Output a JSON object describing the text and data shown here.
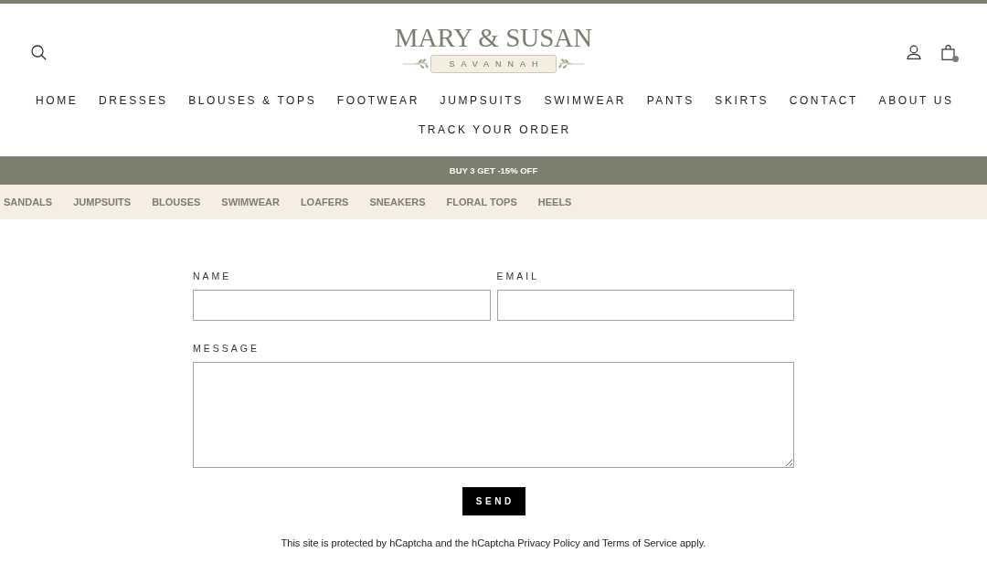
{
  "header": {
    "logo": {
      "title": "MARY & SUSAN",
      "subtitle": "SAVANNAH"
    },
    "cart": {
      "has_items": true
    }
  },
  "nav": {
    "items": [
      "HOME",
      "DRESSES",
      "BLOUSES & TOPS",
      "FOOTWEAR",
      "JUMPSUITS",
      "SWIMWEAR",
      "PANTS",
      "SKIRTS",
      "CONTACT",
      "ABOUT US",
      "TRACK YOUR ORDER"
    ]
  },
  "announcement_bar": {
    "text": "BUY 3 GET -15% OFF"
  },
  "category_strip": {
    "items": [
      "SANDALS",
      "JUMPSUITS",
      "BLOUSES",
      "SWIMWEAR",
      "LOAFERS",
      "SNEAKERS",
      "FLORAL TOPS",
      "HEELS"
    ]
  },
  "contact_form": {
    "fields": [
      {
        "kind": "input",
        "label": "NAME"
      },
      {
        "kind": "input",
        "label": "EMAIL"
      },
      {
        "kind": "textarea",
        "label": "MESSAGE"
      }
    ],
    "button": "SEND",
    "notice": "This site is protected by hCaptcha and the hCaptcha Privacy Policy and Terms of Service apply."
  }
}
